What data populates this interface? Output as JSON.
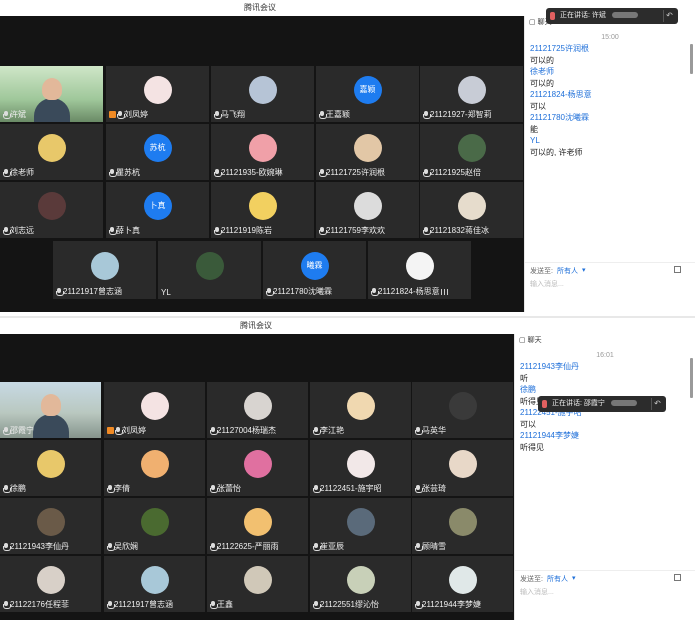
{
  "window1": {
    "title": "腾讯会议",
    "speaking_toast": "正在讲话: 许斌",
    "participants": [
      {
        "name": "许斌",
        "kind": "video"
      },
      {
        "name": "刘凤婷",
        "kind": "avatar",
        "color": "#f4e3e3",
        "host": true
      },
      {
        "name": "马飞翔",
        "kind": "avatar",
        "color": "#b6c4d6"
      },
      {
        "name": "王嘉颖",
        "kind": "text",
        "initials": "嘉颖"
      },
      {
        "name": "21121927-郑智莉",
        "kind": "avatar",
        "color": "#c8ccd6"
      },
      {
        "name": "徐老师",
        "kind": "avatar",
        "color": "#e8c86a"
      },
      {
        "name": "瞿苏杭",
        "kind": "text",
        "initials": "苏杭"
      },
      {
        "name": "21121935-欧婉琳",
        "kind": "avatar",
        "color": "#f0a0a8"
      },
      {
        "name": "21121725许润根",
        "kind": "avatar",
        "color": "#e2c7a6"
      },
      {
        "name": "21121925赵倍",
        "kind": "avatar",
        "color": "#4a6a48"
      },
      {
        "name": "刘志远",
        "kind": "avatar",
        "color": "#5a3a3a"
      },
      {
        "name": "薛卜真",
        "kind": "text",
        "initials": "卜真"
      },
      {
        "name": "21121919陈岩",
        "kind": "avatar",
        "color": "#f2d060"
      },
      {
        "name": "21121759李欢欢",
        "kind": "avatar",
        "color": "#dcdcdc"
      },
      {
        "name": "21121832蒋佳冰",
        "kind": "avatar",
        "color": "#e6dccc"
      },
      {
        "name": "21121917曾志涵",
        "kind": "avatar",
        "color": "#a8c8d8"
      },
      {
        "name": "YL",
        "kind": "avatar",
        "color": "#3a5a3a",
        "nomic": true
      },
      {
        "name": "21121780沈曦霖",
        "kind": "text",
        "initials": "曦霖"
      },
      {
        "name": "21121824-杨思意",
        "kind": "avatar",
        "color": "#f4f4f4",
        "level": true
      }
    ],
    "chat": {
      "header": "聊天",
      "time": "15:00",
      "messages": [
        {
          "sender": "21121725许润根",
          "text": "可以的"
        },
        {
          "sender": "徐老师",
          "text": "可以的"
        },
        {
          "sender": "21121824-杨思意",
          "text": "可以"
        },
        {
          "sender": "21121780沈曦霖",
          "text": "能"
        },
        {
          "sender": "YL",
          "text": "可以的, 许老师"
        }
      ],
      "to_label": "发送至:",
      "to_value": "所有人",
      "placeholder": "输入消息..."
    }
  },
  "window2": {
    "title": "腾讯会议",
    "speaking_toast": "正在讲话: 邵霞宁",
    "participants": [
      {
        "name": "邵霞宁",
        "kind": "video"
      },
      {
        "name": "刘凤婷",
        "kind": "avatar",
        "color": "#f4e3e3",
        "host": true
      },
      {
        "name": "21127004杨瑞杰",
        "kind": "avatar",
        "color": "#d8d4d0"
      },
      {
        "name": "李江艳",
        "kind": "avatar",
        "color": "#f0d8b0"
      },
      {
        "name": "马英华",
        "kind": "avatar",
        "color": "#3a3a3a"
      },
      {
        "name": "徐鹏",
        "kind": "avatar",
        "color": "#e8c86a"
      },
      {
        "name": "李倩",
        "kind": "avatar",
        "color": "#f0b070"
      },
      {
        "name": "张蕾怡",
        "kind": "avatar",
        "color": "#e070a0"
      },
      {
        "name": "21122451-施宇昭",
        "kind": "avatar",
        "color": "#f2e8e8"
      },
      {
        "name": "张芸琦",
        "kind": "avatar",
        "color": "#e8d8c8"
      },
      {
        "name": "21121943李仙丹",
        "kind": "avatar",
        "color": "#6a5a48"
      },
      {
        "name": "吴欣娴",
        "kind": "avatar",
        "color": "#4a6a30"
      },
      {
        "name": "21122625-严丽雨",
        "kind": "avatar",
        "color": "#f2c070"
      },
      {
        "name": "崔亚辰",
        "kind": "avatar",
        "color": "#5a6a7a"
      },
      {
        "name": "顾晴雪",
        "kind": "avatar",
        "color": "#8a8a6a"
      },
      {
        "name": "21122176任程菲",
        "kind": "avatar",
        "color": "#d8d0c8"
      },
      {
        "name": "21121917曾志涵",
        "kind": "avatar",
        "color": "#a8c8d8"
      },
      {
        "name": "王鑫",
        "kind": "avatar",
        "color": "#d0c8b8"
      },
      {
        "name": "21122551缪沁怡",
        "kind": "avatar",
        "color": "#c8d0b8"
      },
      {
        "name": "21121944李梦婕",
        "kind": "avatar",
        "color": "#e0e8e8"
      }
    ],
    "chat": {
      "header": "聊天",
      "time": "16:01",
      "messages": [
        {
          "sender": "21121943李仙丹",
          "text": "听"
        },
        {
          "sender": "徐鹏",
          "text": "听得见"
        },
        {
          "sender": "21122451-施宇昭",
          "text": "可以"
        },
        {
          "sender": "21121944李梦婕",
          "text": "听得见"
        }
      ],
      "to_label": "发送至:",
      "to_value": "所有人",
      "placeholder": "输入消息..."
    }
  }
}
